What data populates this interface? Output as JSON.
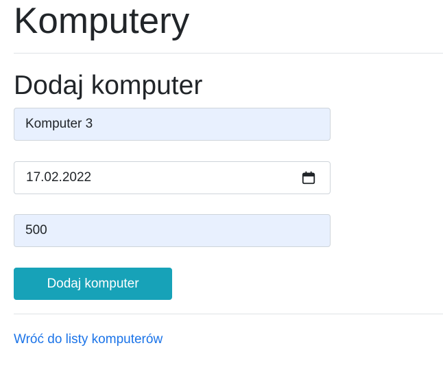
{
  "header": {
    "title": "Komputery"
  },
  "form": {
    "heading": "Dodaj komputer",
    "name_value": "Komputer 3",
    "date_value": "17.02.2022",
    "price_value": "500",
    "submit_label": "Dodaj komputer"
  },
  "footer": {
    "back_link_label": "Wróć do listy komputerów"
  },
  "icons": {
    "date_picker": "calendar-icon"
  },
  "colors": {
    "button": "#17a2b8",
    "link": "#1a73e8",
    "autofill_background": "#e8f0fe",
    "divider": "#dee2e6"
  }
}
